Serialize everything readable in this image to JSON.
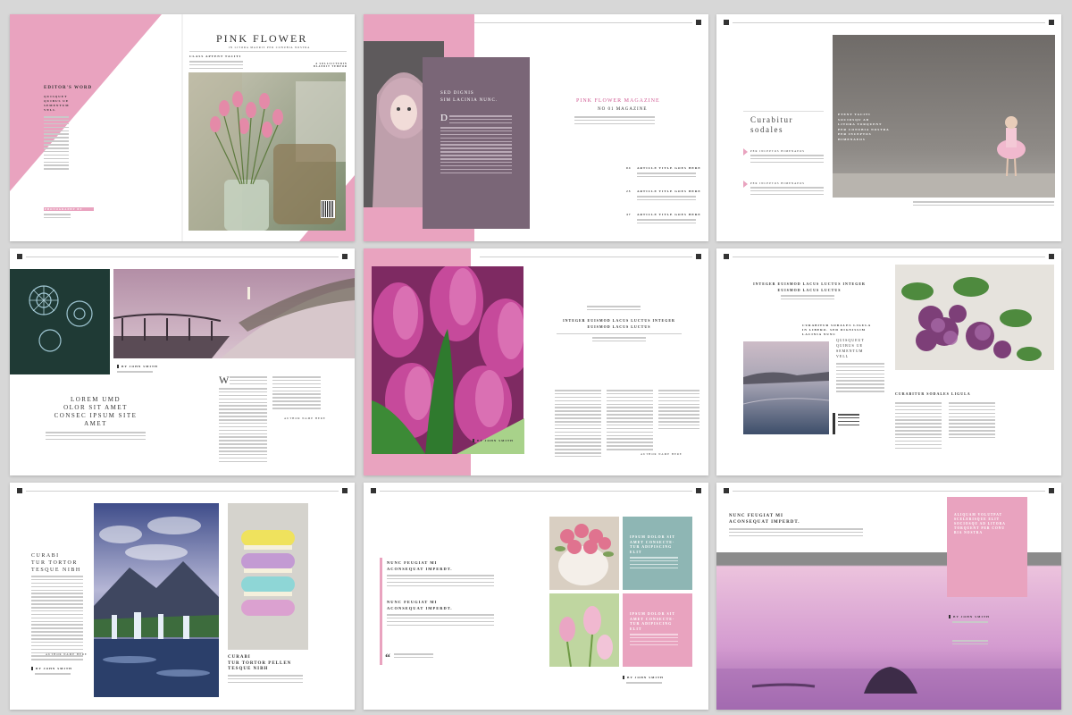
{
  "colors": {
    "pink": "#e9a3bf",
    "mauve": "#7a6677",
    "dark": "#333333",
    "green": "#a8d28a",
    "teal": "#8eb6b4"
  },
  "spread1": {
    "title": "PINK FLOWER",
    "subtitle": "IN LITORA MAURIS PER CONUBIA NOSTRA",
    "line1": "CLASS APTENT TACITI",
    "editors_word": "EDITOR'S WORD",
    "editor_sub": "QUISQUET\nQUIBUS UE\nSEMENTUM\nVELL",
    "side_note": "A SOLLICITUDIN\nBLANDIT TEMPOR",
    "photo_label": "PHOTOGRAPHY BY"
  },
  "spread2": {
    "box_title": "SED DIGNIS\nSIM LACINIA NUNC.",
    "mag_title": "PINK FLOWER MAGAZINE",
    "mag_no": "NO 01 MAGAZINE",
    "articles": [
      {
        "num": "04",
        "title": "ARTICLE TITLE GOES HERE"
      },
      {
        "num": "25",
        "title": "ARTICLE TITLE GOES HERE"
      },
      {
        "num": "47",
        "title": "ARTICLE TITLE GOES HERE"
      }
    ]
  },
  "spread3": {
    "title": "Curabitur\nsodales",
    "items": [
      "PER INCEPTOS HIMENAEOS",
      "PER INCEPTOS HIMENAEOS"
    ],
    "quote": "PTENT TACITI\nSOCIOSQU AD\nLITORA TORQUENT\nPER CONUBIA NOSTRA\nPER INCEPTOS\nHIMENAEOS"
  },
  "spread4": {
    "byline": "BY JOHN SMITH",
    "headline": "LOREM UMD\nOLOR SIT AMET\nCONSEC IPSUM SITE\nAMET",
    "drop": "W",
    "author": "AUTHOR NAME HERE"
  },
  "spread5": {
    "heading": "INTEGER EUISMOD LACUS LUCTUS INTEGER\nEUISMOD LACUS LUCTUS",
    "byline": "BY JOHN SMITH",
    "author": "AUTHOR NAME HERE"
  },
  "spread6": {
    "heading": "INTEGER EUISMOD LACUS LUCTUS INTEGER\nEUISMOD LACUS LUCTUS",
    "sub1": "CURABITUR SODALES LIGULA\nIN LIBERO. SED DIGNISSIM\nLACINIA NUNC",
    "quote": "QUISQUEUT\nQUIBUS UE\nSEMENTUM\nVELL",
    "sub2": "CURABITUR SODALES LIGULA"
  },
  "spread7": {
    "title": "CURABI\nTUR TORTOR\nTESQUE NIBH",
    "caption": "CURABI\nTUR TORTOR PELLEN\nTESQUE NIBH",
    "byline": "BY JOHN SMITH",
    "author": "AUTHOR NAME HERE"
  },
  "spread8": {
    "heading1": "NUNC FEUGIAT MI\nACONSEQUAT IMPERDT.",
    "heading2": "NUNC FEUGIAT MI\nACONSEQUAT IMPERDT.",
    "teal_text": "IPSUM DOLOR SIT\nAMET CONSECTE-\nTUR ADIPISCING\nELIT",
    "pink_text": "IPSUM DOLOR SIT\nAMET CONSECTE-\nTUR ADIPISCING\nELIT",
    "byline": "BY JOHN SMITH"
  },
  "spread9": {
    "heading": "NUNC FEUGIAT MI\nACONSEQUAT IMPERDT.",
    "pink_text": "ALIQUAM VOLUTPAT\nSCELERISQUE ELIT\nSOCIOSQU AD LITORA\nTORQUENT PER CONU\nBIA NOSTRA",
    "byline": "BY JOHN SMITH"
  }
}
